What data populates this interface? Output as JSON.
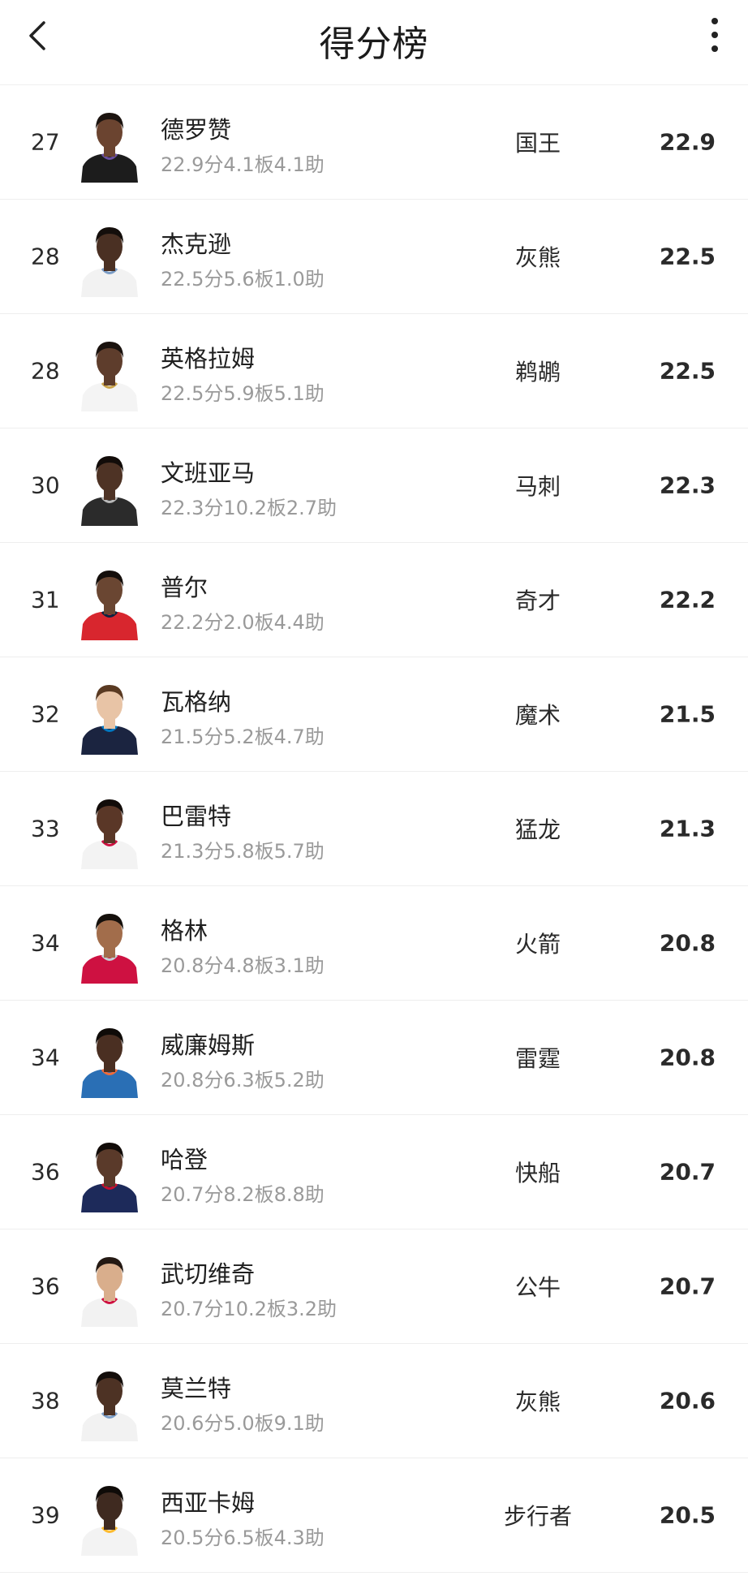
{
  "header": {
    "title": "得分榜"
  },
  "players": [
    {
      "rank": "27",
      "name": "德罗赞",
      "stats": "22.9分4.1板4.1助",
      "team": "国王",
      "score": "22.9",
      "skin": "#6b4430",
      "hair": "#1c1410",
      "jersey": "#1c1c1c",
      "trim": "#6a4fa0"
    },
    {
      "rank": "28",
      "name": "杰克逊",
      "stats": "22.5分5.6板1.0助",
      "team": "灰熊",
      "score": "22.5",
      "skin": "#4a3023",
      "hair": "#140e0b",
      "jersey": "#f2f2f2",
      "trim": "#7a9cc6"
    },
    {
      "rank": "28",
      "name": "英格拉姆",
      "stats": "22.5分5.9板5.1助",
      "team": "鹈鹕",
      "score": "22.5",
      "skin": "#5e3d2c",
      "hair": "#1a120e",
      "jersey": "#f4f4f4",
      "trim": "#c9a34a"
    },
    {
      "rank": "30",
      "name": "文班亚马",
      "stats": "22.3分10.2板2.7助",
      "team": "马刺",
      "score": "22.3",
      "skin": "#4e3325",
      "hair": "#120c09",
      "jersey": "#2b2b2b",
      "trim": "#b8b8b8"
    },
    {
      "rank": "31",
      "name": "普尔",
      "stats": "22.2分2.0板4.4助",
      "team": "奇才",
      "score": "22.2",
      "skin": "#6a4632",
      "hair": "#140e0b",
      "jersey": "#d8262e",
      "trim": "#0c2340"
    },
    {
      "rank": "32",
      "name": "瓦格纳",
      "stats": "21.5分5.2板4.7助",
      "team": "魔术",
      "score": "21.5",
      "skin": "#e8c4a6",
      "hair": "#5a3a22",
      "jersey": "#1b2440",
      "trim": "#0077c0"
    },
    {
      "rank": "33",
      "name": "巴雷特",
      "stats": "21.3分5.8板5.7助",
      "team": "猛龙",
      "score": "21.3",
      "skin": "#5a3727",
      "hair": "#120c09",
      "jersey": "#f3f3f3",
      "trim": "#ce1141"
    },
    {
      "rank": "34",
      "name": "格林",
      "stats": "20.8分4.8板3.1助",
      "team": "火箭",
      "score": "20.8",
      "skin": "#a26d4b",
      "hair": "#15100c",
      "jersey": "#ce1141",
      "trim": "#c4ced4"
    },
    {
      "rank": "34",
      "name": "威廉姆斯",
      "stats": "20.8分6.3板5.2助",
      "team": "雷霆",
      "score": "20.8",
      "skin": "#4a2f22",
      "hair": "#0f0b08",
      "jersey": "#2a6fb5",
      "trim": "#ef6b3b"
    },
    {
      "rank": "36",
      "name": "哈登",
      "stats": "20.7分8.2板8.8助",
      "team": "快船",
      "score": "20.7",
      "skin": "#5a3a2a",
      "hair": "#120c09",
      "jersey": "#1d2a5a",
      "trim": "#c8102e"
    },
    {
      "rank": "36",
      "name": "武切维奇",
      "stats": "20.7分10.2板3.2助",
      "team": "公牛",
      "score": "20.7",
      "skin": "#d9ae8c",
      "hair": "#241913",
      "jersey": "#f2f2f2",
      "trim": "#ce1141"
    },
    {
      "rank": "38",
      "name": "莫兰特",
      "stats": "20.6分5.0板9.1助",
      "team": "灰熊",
      "score": "20.6",
      "skin": "#4d3224",
      "hair": "#140e0b",
      "jersey": "#f2f2f2",
      "trim": "#7a9cc6"
    },
    {
      "rank": "39",
      "name": "西亚卡姆",
      "stats": "20.5分6.5板4.3助",
      "team": "步行者",
      "score": "20.5",
      "skin": "#3f2a20",
      "hair": "#0f0b08",
      "jersey": "#f3f3f3",
      "trim": "#fdbb30"
    }
  ]
}
